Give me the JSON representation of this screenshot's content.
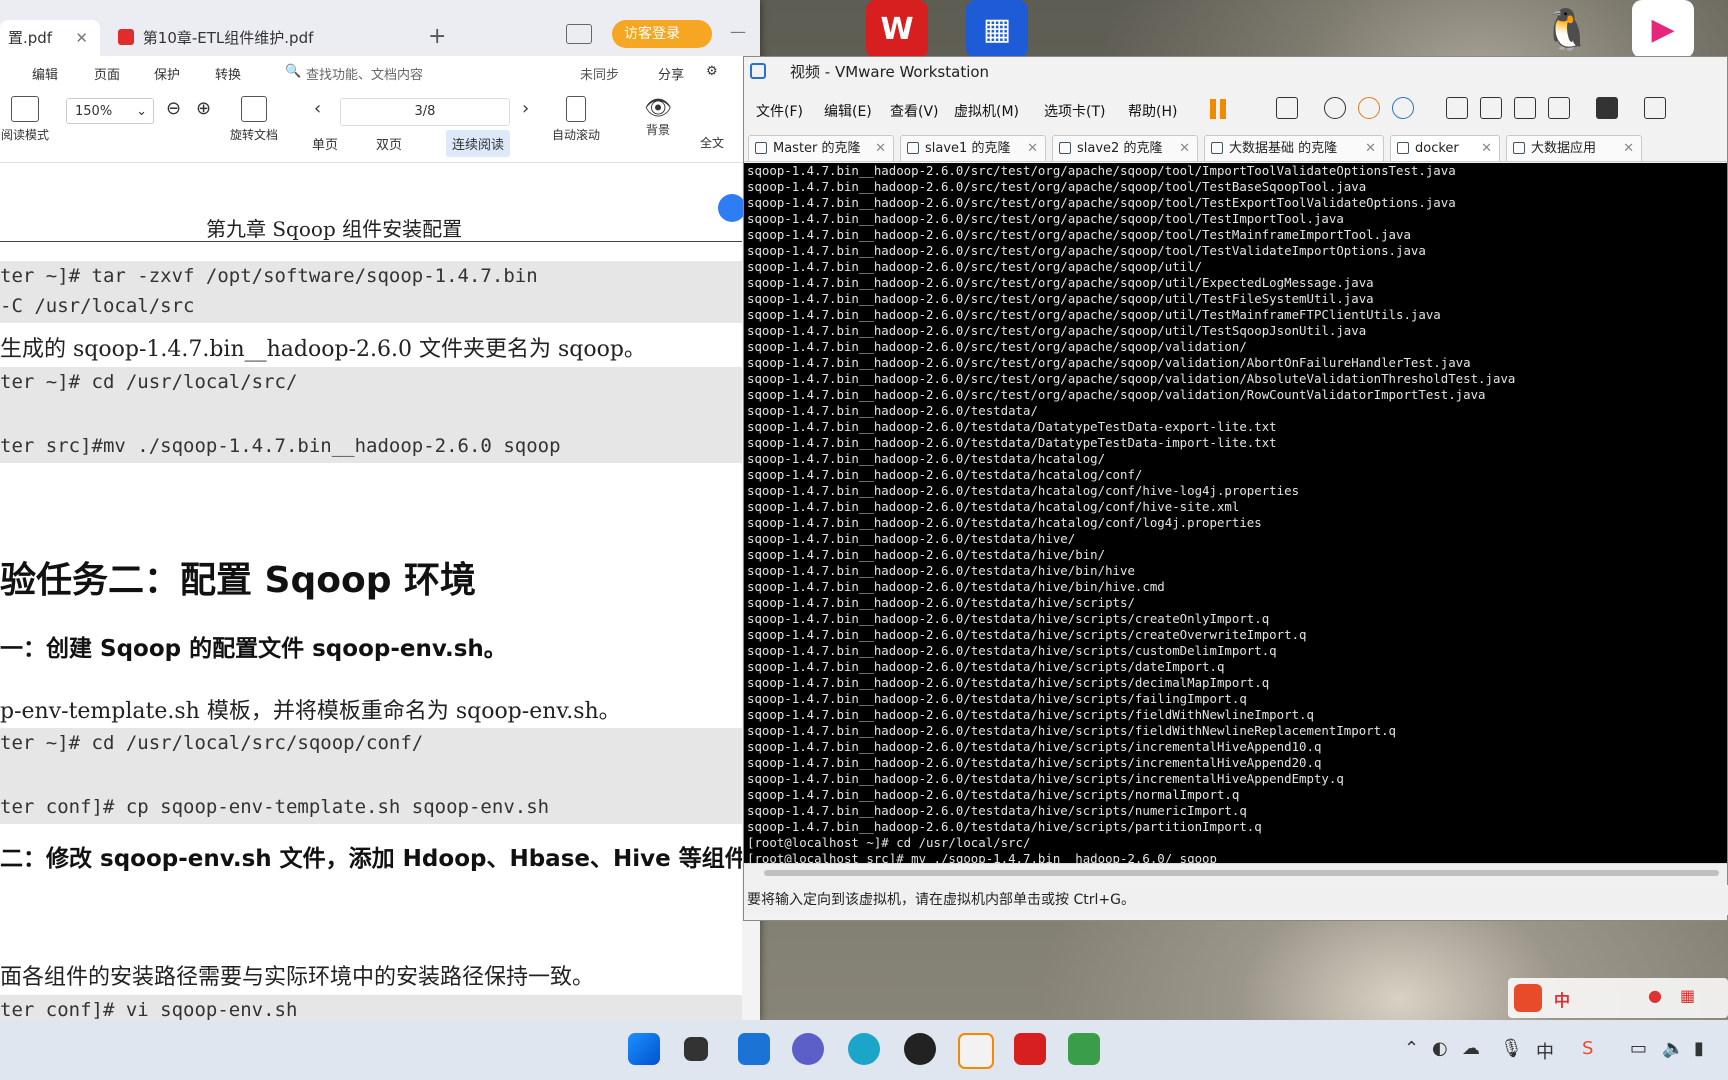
{
  "pdf": {
    "tabs": [
      {
        "label": "置.pdf"
      },
      {
        "label": "第10章-ETL组件维护.pdf"
      }
    ],
    "new_tab": "+",
    "login_button": "访客登录",
    "menu": [
      "编辑",
      "页面",
      "保护",
      "转换"
    ],
    "search_placeholder": "查找功能、文档内容",
    "sync": "未同步",
    "share": "分享",
    "zoom": "150%",
    "page_indicator": "3/8",
    "toolbar": {
      "read_mode": "阅读模式",
      "rotate": "旋转文档",
      "single": "单页",
      "double": "双页",
      "continuous": "连续阅读",
      "auto_scroll": "自动滚动",
      "background": "背景",
      "full": "全文"
    },
    "header": "第九章  Sqoop 组件安装配置",
    "lines": {
      "code1a": "ter  ~]#  tar  -zxvf  /opt/software/sqoop-1.4.7.bin",
      "code1b": " -C /usr/local/src",
      "p1": "生成的 sqoop-1.4.7.bin__hadoop-2.6.0 文件夹更名为 sqoop。",
      "code2": "ter ~]# cd /usr/local/src/",
      "code3": "ter src]#mv ./sqoop-1.4.7.bin__hadoop-2.6.0 sqoop",
      "h2": "验任务二：配置 Sqoop 环境",
      "h3a": "一：创建 Sqoop 的配置文件 sqoop-env.sh。",
      "p2": "p-env-template.sh 模板，并将模板重命名为 sqoop-env.sh。",
      "code4": "ter ~]# cd /usr/local/src/sqoop/conf/",
      "code5": "ter conf]# cp sqoop-env-template.sh sqoop-env.sh",
      "h3b": "二：修改 sqoop-env.sh 文件，添加 Hdoop、Hbase、Hive 等组件",
      "p3": "面各组件的安装路径需要与实际环境中的安装路径保持一致。",
      "code6": "ter conf]# vi sqoop-env.sh"
    }
  },
  "vm": {
    "title": "视频 - VMware Workstation",
    "menu": [
      "文件(F)",
      "编辑(E)",
      "查看(V)",
      "虚拟机(M)",
      "选项卡(T)",
      "帮助(H)"
    ],
    "tabs": [
      "Master 的克隆",
      "slave1 的克隆",
      "slave2 的克隆",
      "大数据基础 的克隆",
      "docker",
      "大数据应用"
    ],
    "terminal_lines": [
      "sqoop-1.4.7.bin__hadoop-2.6.0/src/test/org/apache/sqoop/tool/ImportToolValidateOptionsTest.java",
      "sqoop-1.4.7.bin__hadoop-2.6.0/src/test/org/apache/sqoop/tool/TestBaseSqoopTool.java",
      "sqoop-1.4.7.bin__hadoop-2.6.0/src/test/org/apache/sqoop/tool/TestExportToolValidateOptions.java",
      "sqoop-1.4.7.bin__hadoop-2.6.0/src/test/org/apache/sqoop/tool/TestImportTool.java",
      "sqoop-1.4.7.bin__hadoop-2.6.0/src/test/org/apache/sqoop/tool/TestMainframeImportTool.java",
      "sqoop-1.4.7.bin__hadoop-2.6.0/src/test/org/apache/sqoop/tool/TestValidateImportOptions.java",
      "sqoop-1.4.7.bin__hadoop-2.6.0/src/test/org/apache/sqoop/util/",
      "sqoop-1.4.7.bin__hadoop-2.6.0/src/test/org/apache/sqoop/util/ExpectedLogMessage.java",
      "sqoop-1.4.7.bin__hadoop-2.6.0/src/test/org/apache/sqoop/util/TestFileSystemUtil.java",
      "sqoop-1.4.7.bin__hadoop-2.6.0/src/test/org/apache/sqoop/util/TestMainframeFTPClientUtils.java",
      "sqoop-1.4.7.bin__hadoop-2.6.0/src/test/org/apache/sqoop/util/TestSqoopJsonUtil.java",
      "sqoop-1.4.7.bin__hadoop-2.6.0/src/test/org/apache/sqoop/validation/",
      "sqoop-1.4.7.bin__hadoop-2.6.0/src/test/org/apache/sqoop/validation/AbortOnFailureHandlerTest.java",
      "sqoop-1.4.7.bin__hadoop-2.6.0/src/test/org/apache/sqoop/validation/AbsoluteValidationThresholdTest.java",
      "sqoop-1.4.7.bin__hadoop-2.6.0/src/test/org/apache/sqoop/validation/RowCountValidatorImportTest.java",
      "sqoop-1.4.7.bin__hadoop-2.6.0/testdata/",
      "sqoop-1.4.7.bin__hadoop-2.6.0/testdata/DatatypeTestData-export-lite.txt",
      "sqoop-1.4.7.bin__hadoop-2.6.0/testdata/DatatypeTestData-import-lite.txt",
      "sqoop-1.4.7.bin__hadoop-2.6.0/testdata/hcatalog/",
      "sqoop-1.4.7.bin__hadoop-2.6.0/testdata/hcatalog/conf/",
      "sqoop-1.4.7.bin__hadoop-2.6.0/testdata/hcatalog/conf/hive-log4j.properties",
      "sqoop-1.4.7.bin__hadoop-2.6.0/testdata/hcatalog/conf/hive-site.xml",
      "sqoop-1.4.7.bin__hadoop-2.6.0/testdata/hcatalog/conf/log4j.properties",
      "sqoop-1.4.7.bin__hadoop-2.6.0/testdata/hive/",
      "sqoop-1.4.7.bin__hadoop-2.6.0/testdata/hive/bin/",
      "sqoop-1.4.7.bin__hadoop-2.6.0/testdata/hive/bin/hive",
      "sqoop-1.4.7.bin__hadoop-2.6.0/testdata/hive/bin/hive.cmd",
      "sqoop-1.4.7.bin__hadoop-2.6.0/testdata/hive/scripts/",
      "sqoop-1.4.7.bin__hadoop-2.6.0/testdata/hive/scripts/createOnlyImport.q",
      "sqoop-1.4.7.bin__hadoop-2.6.0/testdata/hive/scripts/createOverwriteImport.q",
      "sqoop-1.4.7.bin__hadoop-2.6.0/testdata/hive/scripts/customDelimImport.q",
      "sqoop-1.4.7.bin__hadoop-2.6.0/testdata/hive/scripts/dateImport.q",
      "sqoop-1.4.7.bin__hadoop-2.6.0/testdata/hive/scripts/decimalMapImport.q",
      "sqoop-1.4.7.bin__hadoop-2.6.0/testdata/hive/scripts/failingImport.q",
      "sqoop-1.4.7.bin__hadoop-2.6.0/testdata/hive/scripts/fieldWithNewlineImport.q",
      "sqoop-1.4.7.bin__hadoop-2.6.0/testdata/hive/scripts/fieldWithNewlineReplacementImport.q",
      "sqoop-1.4.7.bin__hadoop-2.6.0/testdata/hive/scripts/incrementalHiveAppend10.q",
      "sqoop-1.4.7.bin__hadoop-2.6.0/testdata/hive/scripts/incrementalHiveAppend20.q",
      "sqoop-1.4.7.bin__hadoop-2.6.0/testdata/hive/scripts/incrementalHiveAppendEmpty.q",
      "sqoop-1.4.7.bin__hadoop-2.6.0/testdata/hive/scripts/normalImport.q",
      "sqoop-1.4.7.bin__hadoop-2.6.0/testdata/hive/scripts/numericImport.q",
      "sqoop-1.4.7.bin__hadoop-2.6.0/testdata/hive/scripts/partitionImport.q",
      "[root@localhost ~]# cd /usr/local/src/",
      "[root@localhost src]# mv ./sqoop-1.4.7.bin__hadoop-2.6.0/ sqoop"
    ],
    "status": "要将输入定向到该虚拟机，请在虚拟机内部单击或按 Ctrl+G。"
  },
  "ime": {
    "lang": "中"
  },
  "colors": {
    "accent": "#1677ff",
    "terminal_bg": "#000000",
    "login_bg": "#f5a623"
  }
}
